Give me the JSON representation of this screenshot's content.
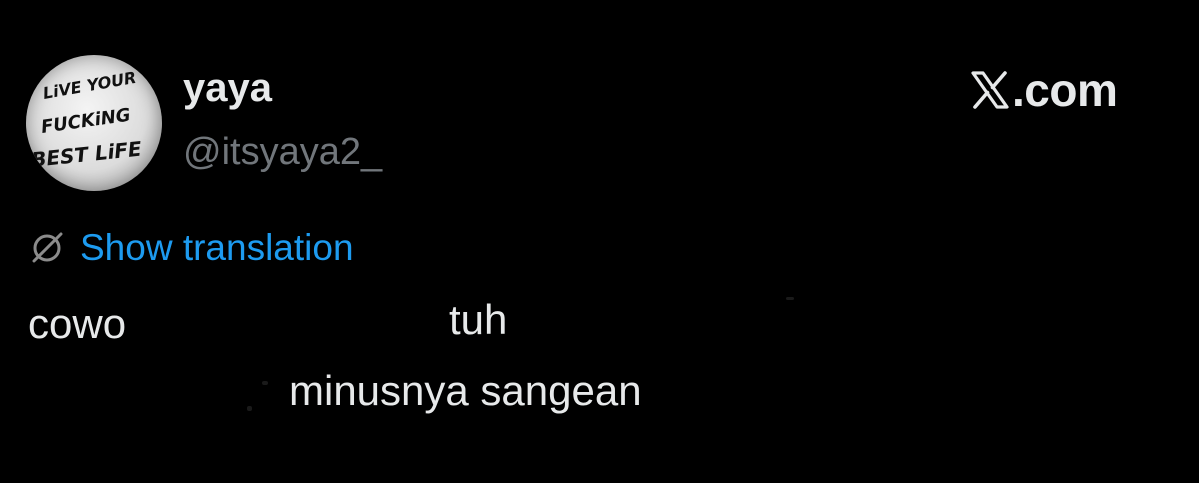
{
  "tweet": {
    "author": {
      "display_name": "yaya",
      "handle": "@itsyaya2_",
      "avatar_text_lines": [
        "LiVE YOUR",
        "FUCKiNG",
        "BEST LiFE"
      ]
    },
    "brand": {
      "icon": "x-logo-icon",
      "text": ".com"
    },
    "translation": {
      "icon": "globe-icon",
      "label": "Show translation",
      "color": "#1d9bf0"
    },
    "text_fragments": [
      "cowo",
      "tuh",
      "minusnya sangean"
    ]
  },
  "colors": {
    "background": "#000000",
    "primary_text": "#e7e9ea",
    "secondary_text": "#71767b",
    "link": "#1d9bf0"
  }
}
